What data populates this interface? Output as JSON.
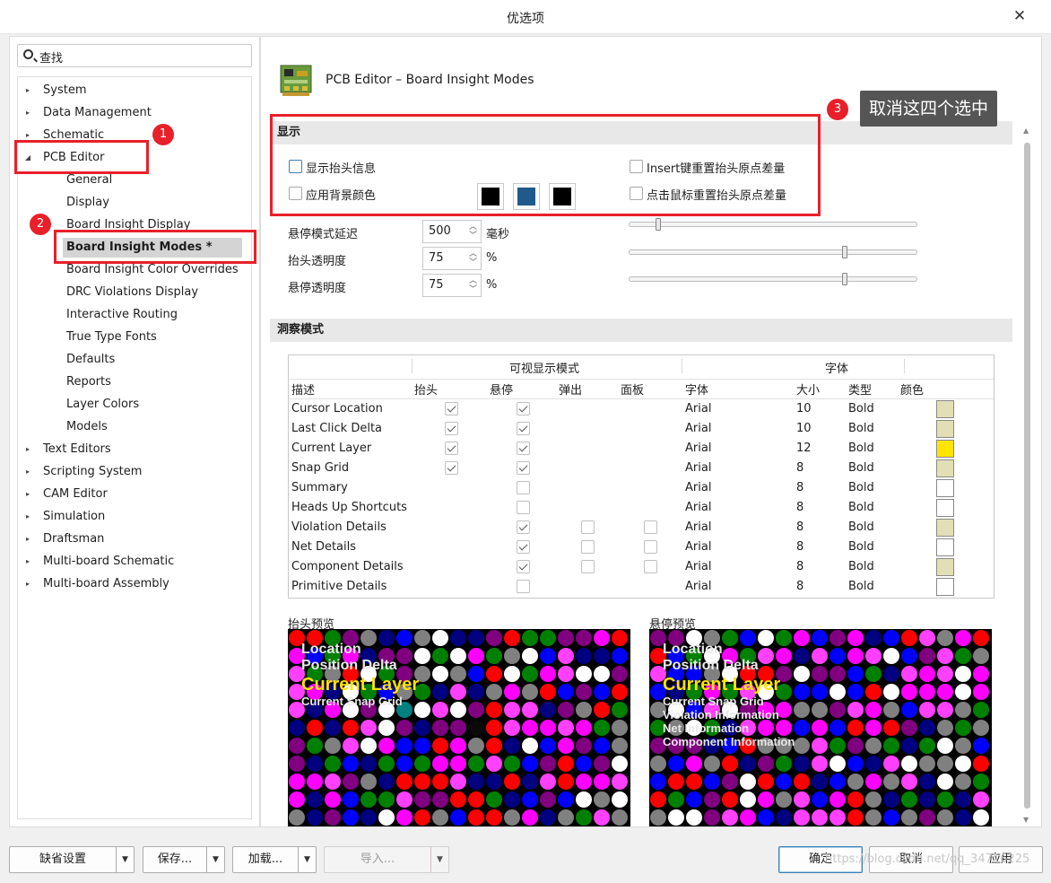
{
  "window": {
    "title": "优选项",
    "close_label": "✕"
  },
  "search": {
    "label": "查找"
  },
  "tree": {
    "items": [
      {
        "label": "System",
        "level": 0
      },
      {
        "label": "Data Management",
        "level": 0
      },
      {
        "label": "Schematic",
        "level": 0
      },
      {
        "label": "PCB Editor",
        "level": 0,
        "expanded": true
      },
      {
        "label": "General",
        "level": 1
      },
      {
        "label": "Display",
        "level": 1
      },
      {
        "label": "Board Insight Display",
        "level": 1
      },
      {
        "label": "Board Insight Modes *",
        "level": 1,
        "selected": true
      },
      {
        "label": "Board Insight Color Overrides",
        "level": 1
      },
      {
        "label": "DRC Violations Display",
        "level": 1
      },
      {
        "label": "Interactive Routing",
        "level": 1
      },
      {
        "label": "True Type Fonts",
        "level": 1
      },
      {
        "label": "Defaults",
        "level": 1
      },
      {
        "label": "Reports",
        "level": 1
      },
      {
        "label": "Layer Colors",
        "level": 1
      },
      {
        "label": "Models",
        "level": 1
      },
      {
        "label": "Text Editors",
        "level": 0
      },
      {
        "label": "Scripting System",
        "level": 0
      },
      {
        "label": "CAM Editor",
        "level": 0
      },
      {
        "label": "Simulation",
        "level": 0
      },
      {
        "label": "Draftsman",
        "level": 0
      },
      {
        "label": "Multi-board Schematic",
        "level": 0
      },
      {
        "label": "Multi-board Assembly",
        "level": 0
      }
    ]
  },
  "page": {
    "title": "PCB Editor – Board Insight Modes"
  },
  "display": {
    "header": "显示",
    "show_heads_up": "显示抬头信息",
    "use_background": "应用背景颜色",
    "insert_reset": "Insert键重置抬头原点差量",
    "click_reset": "点击鼠标重置抬头原点差量",
    "swatch_colors": [
      "#000000",
      "#1f5a8a",
      "#000000"
    ],
    "hover_delay_label": "悬停模式延迟",
    "hover_delay_value": "500",
    "hover_delay_unit": "毫秒",
    "headsup_opacity_label": "抬头透明度",
    "headsup_opacity_value": "75",
    "hover_opacity_label": "悬停透明度",
    "hover_opacity_value": "75",
    "percent": "%",
    "slider_levels": [
      0.09,
      0.74,
      0.74
    ]
  },
  "insight": {
    "header": "洞察模式",
    "group_visible": "可视显示模式",
    "group_font": "字体",
    "cols": {
      "desc": "描述",
      "headsup": "抬头",
      "hover": "悬停",
      "popup": "弹出",
      "panel": "面板",
      "font": "字体",
      "size": "大小",
      "type": "类型",
      "color": "颜色"
    },
    "rows": [
      {
        "desc": "Cursor Location",
        "headsup": true,
        "hover": true,
        "popup": null,
        "panel": null,
        "font": "Arial",
        "size": "10",
        "type": "Bold",
        "color": "#e2dfb6"
      },
      {
        "desc": "Last Click Delta",
        "headsup": true,
        "hover": true,
        "popup": null,
        "panel": null,
        "font": "Arial",
        "size": "10",
        "type": "Bold",
        "color": "#e2dfb6"
      },
      {
        "desc": "Current Layer",
        "headsup": true,
        "hover": true,
        "popup": null,
        "panel": null,
        "font": "Arial",
        "size": "12",
        "type": "Bold",
        "color": "#ffe400"
      },
      {
        "desc": "Snap Grid",
        "headsup": true,
        "hover": true,
        "popup": null,
        "panel": null,
        "font": "Arial",
        "size": "8",
        "type": "Bold",
        "color": "#e2dfb6"
      },
      {
        "desc": "Summary",
        "headsup": null,
        "hover": false,
        "popup": null,
        "panel": null,
        "font": "Arial",
        "size": "8",
        "type": "Bold",
        "color": "#ffffff"
      },
      {
        "desc": "Heads Up Shortcuts",
        "headsup": null,
        "hover": false,
        "popup": null,
        "panel": null,
        "font": "Arial",
        "size": "8",
        "type": "Bold",
        "color": "#ffffff"
      },
      {
        "desc": "Violation Details",
        "headsup": null,
        "hover": true,
        "popup": false,
        "panel": false,
        "font": "Arial",
        "size": "8",
        "type": "Bold",
        "color": "#e2dfb6"
      },
      {
        "desc": "Net Details",
        "headsup": null,
        "hover": true,
        "popup": false,
        "panel": false,
        "font": "Arial",
        "size": "8",
        "type": "Bold",
        "color": "#ffffff"
      },
      {
        "desc": "Component Details",
        "headsup": null,
        "hover": true,
        "popup": false,
        "panel": false,
        "font": "Arial",
        "size": "8",
        "type": "Bold",
        "color": "#e2dfb6"
      },
      {
        "desc": "Primitive Details",
        "headsup": null,
        "hover": false,
        "popup": null,
        "panel": null,
        "font": "Arial",
        "size": "8",
        "type": "Bold",
        "color": "#ffffff"
      }
    ]
  },
  "previews": {
    "headsup_label": "抬头预览",
    "hover_label": "悬停预览",
    "headsup_lines": [
      "Location",
      "Position Delta",
      "Current Layer",
      "Current Snap Grid"
    ],
    "hover_lines": [
      "Location",
      "Position Delta",
      "Current Layer",
      "Current Snap Grid",
      "Violation Information",
      "Net Information",
      "Component Information"
    ],
    "dot_colors": [
      "#ff0000",
      "#00ff00",
      "#0000ff",
      "#ffff00",
      "#ff00ff",
      "#00ffff",
      "#ffffff",
      "#c0c0c0",
      "#808080",
      "#808000",
      "#008000",
      "#008080",
      "#800080",
      "#800000",
      "#000080",
      "#00c0c0",
      "#ff40ff",
      "#0a0a0a"
    ]
  },
  "buttons": {
    "defaults": "缺省设置",
    "save": "保存...",
    "load": "加载...",
    "import": "导入...",
    "ok": "确定",
    "cancel": "取消",
    "apply": "应用"
  },
  "annotations": {
    "badge1": "1",
    "badge2": "2",
    "badge3": "3",
    "tip": "取消这四个选中",
    "watermark": "https://blog.csdn.net/qq_34716225"
  },
  "colors": {
    "annotation_red": "#e8202a",
    "selected_bg": "#d4d4d4",
    "header_bg": "#e8e8e8"
  }
}
